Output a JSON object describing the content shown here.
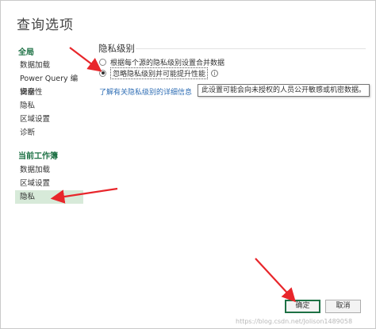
{
  "window": {
    "title": "查询选项"
  },
  "sidebar": {
    "global_heading": "全局",
    "global_items": [
      {
        "label": "数据加载"
      },
      {
        "label": "Power Query 编辑器"
      },
      {
        "label": "安全性"
      },
      {
        "label": "隐私"
      },
      {
        "label": "区域设置"
      },
      {
        "label": "诊断"
      }
    ],
    "workbook_heading": "当前工作簿",
    "workbook_items": [
      {
        "label": "数据加载"
      },
      {
        "label": "区域设置"
      },
      {
        "label": "隐私",
        "selected": true
      }
    ]
  },
  "privacy": {
    "heading": "隐私级别",
    "option_combine": "根据每个源的隐私级别设置合并数据",
    "option_ignore": "忽略隐私级别并可能提升性能",
    "selected": "option_ignore",
    "info_icon": "i",
    "learn_more_link": "了解有关隐私级别的详细信息",
    "tooltip": "此设置可能会向未授权的人员公开敏感或机密数据。"
  },
  "footer": {
    "ok_label": "确定",
    "cancel_label": "取消",
    "watermark": "https://blog.csdn.net/Jolison1489058"
  },
  "colors": {
    "accent_green": "#1e7145",
    "selected_bg": "#d7ead9",
    "link_blue": "#2e6db4",
    "annotation_red": "#e8262b"
  }
}
